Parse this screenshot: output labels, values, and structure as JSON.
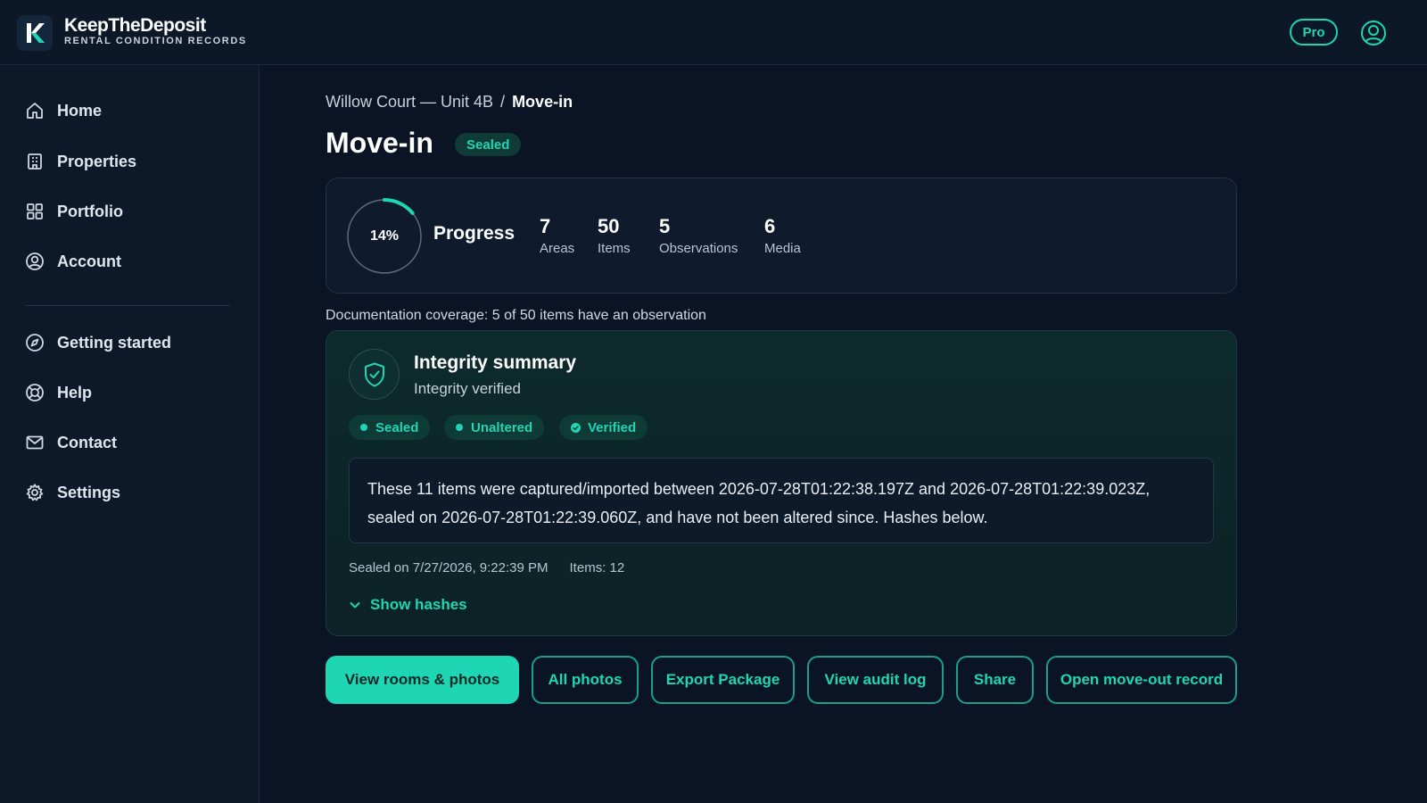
{
  "app": {
    "brand_name": "KeepTheDeposit",
    "brand_tagline": "RENTAL CONDITION RECORDS",
    "plan_badge": "Pro",
    "accent": "#1fd6b4"
  },
  "sidebar": {
    "items": [
      {
        "label": "Home",
        "icon": "home-icon"
      },
      {
        "label": "Properties",
        "icon": "building-icon"
      },
      {
        "label": "Portfolio",
        "icon": "grid-icon"
      },
      {
        "label": "Account",
        "icon": "user-circle-icon"
      }
    ],
    "secondary_items": [
      {
        "label": "Getting started",
        "icon": "compass-icon"
      },
      {
        "label": "Help",
        "icon": "lifebuoy-icon"
      },
      {
        "label": "Contact",
        "icon": "mail-icon"
      },
      {
        "label": "Settings",
        "icon": "gear-icon"
      }
    ]
  },
  "breadcrumb": {
    "parent": "Willow Court — Unit 4B",
    "separator": "/",
    "current": "Move-in"
  },
  "page": {
    "title": "Move-in",
    "status_badge": "Sealed"
  },
  "progress": {
    "percent_label": "14%",
    "percent_value": 14,
    "label": "Progress",
    "stats": [
      {
        "value": "7",
        "label": "Areas"
      },
      {
        "value": "50",
        "label": "Items"
      },
      {
        "value": "5",
        "label": "Observations"
      },
      {
        "value": "6",
        "label": "Media"
      }
    ]
  },
  "coverage_text": "Documentation coverage: 5 of 50 items have an observation",
  "integrity": {
    "title": "Integrity summary",
    "subtitle": "Integrity verified",
    "pills": [
      "Sealed",
      "Unaltered",
      "Verified"
    ],
    "summary": "These 11 items were captured/imported between 2026-07-28T01:22:38.197Z and 2026-07-28T01:22:39.023Z, sealed on 2026-07-28T01:22:39.060Z, and have not been altered since. Hashes below.",
    "sealed_on": "Sealed on 7/27/2026, 9:22:39 PM",
    "items_count": "Items: 12",
    "show_hashes": "Show hashes"
  },
  "actions": {
    "view_rooms": "View rooms & photos",
    "all_photos": "All photos",
    "export": "Export Package",
    "audit_log": "View audit log",
    "share": "Share",
    "move_out": "Open move-out record"
  }
}
